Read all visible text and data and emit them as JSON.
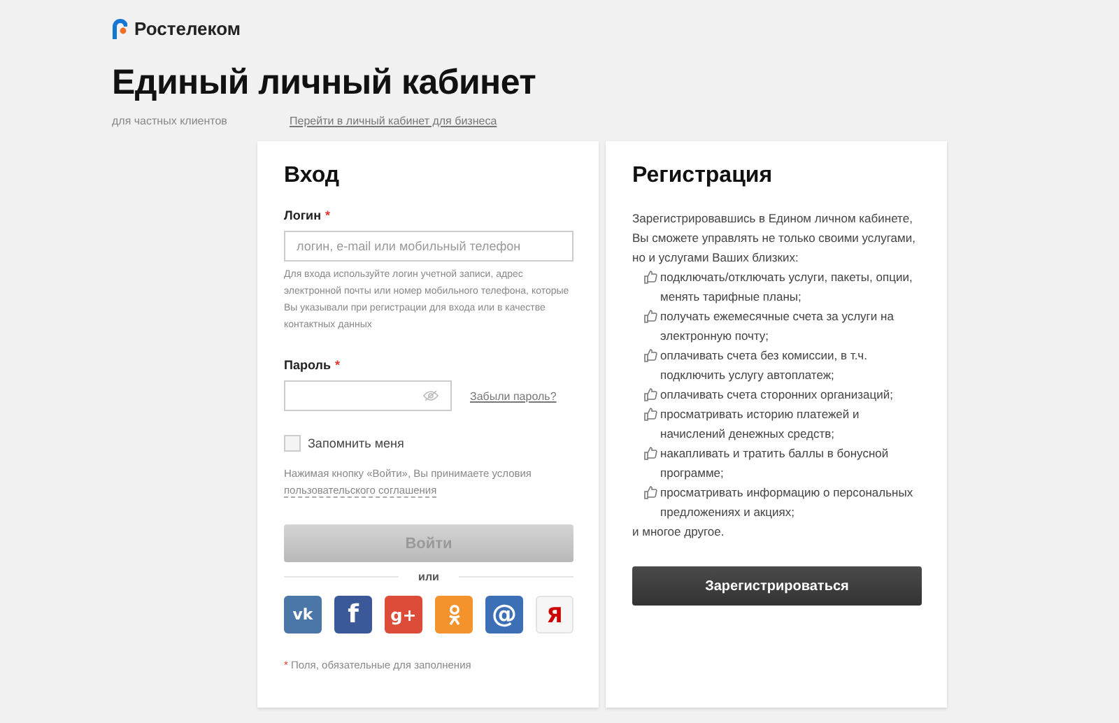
{
  "brand": {
    "name": "Ростелеком"
  },
  "title": "Единый личный кабинет",
  "subtitle": "для частных клиентов",
  "business_link": "Перейти в личный кабинет для бизнеса",
  "login": {
    "title": "Вход",
    "login_label": "Логин",
    "login_required": "*",
    "login_placeholder": "логин, e-mail или мобильный телефон",
    "login_hint": "Для входа используйте логин учетной записи, адрес электронной почты или номер мобильного телефона, которые Вы указывали при регистрации для входа или в качестве контактных данных",
    "password_label": "Пароль",
    "password_required": "*",
    "forgot_link": "Забыли пароль?",
    "remember": {
      "label": "Запомнить меня",
      "checked": false
    },
    "terms_text": "Нажимая кнопку «Войти», Вы принимаете условия",
    "terms_link": "пользовательского соглашения",
    "submit": {
      "label": "Войти",
      "disabled": true
    },
    "divider": "или",
    "socials": [
      {
        "kind": "vk",
        "glyph": "vk",
        "color": "#4a76a8"
      },
      {
        "kind": "text",
        "glyph": "f",
        "color": "#3b5998"
      },
      {
        "kind": "text",
        "glyph": "g+",
        "color": "#dd4b39"
      },
      {
        "kind": "ok",
        "color": "#f4922b"
      },
      {
        "kind": "text",
        "glyph": "@",
        "color": "#3d6fb6"
      },
      {
        "kind": "light",
        "glyph": "Я",
        "color": "#cc0000"
      }
    ],
    "footnote_mark": "*",
    "footnote": "Поля, обязательные для заполнения"
  },
  "register": {
    "title": "Регистрация",
    "intro": "Зарегистрировавшись в Едином личном кабинете, Вы сможете управлять не только своими услугами, но и услугами Ваших близких:",
    "benefits": [
      "подключать/отключать услуги, пакеты, опции, менять тарифные планы;",
      "получать ежемесячные счета за услуги на электронную почту;",
      "оплачивать счета без комиссии, в т.ч. подключить услугу автоплатеж;",
      "оплачивать счета сторонних организаций;",
      "просматривать историю платежей и начислений денежных средств;",
      "накапливать и тратить баллы в бонусной программе;",
      "просматривать информацию о персональных предложениях и акциях;"
    ],
    "outro": "и многое другое.",
    "button": "Зарегистрироваться"
  }
}
